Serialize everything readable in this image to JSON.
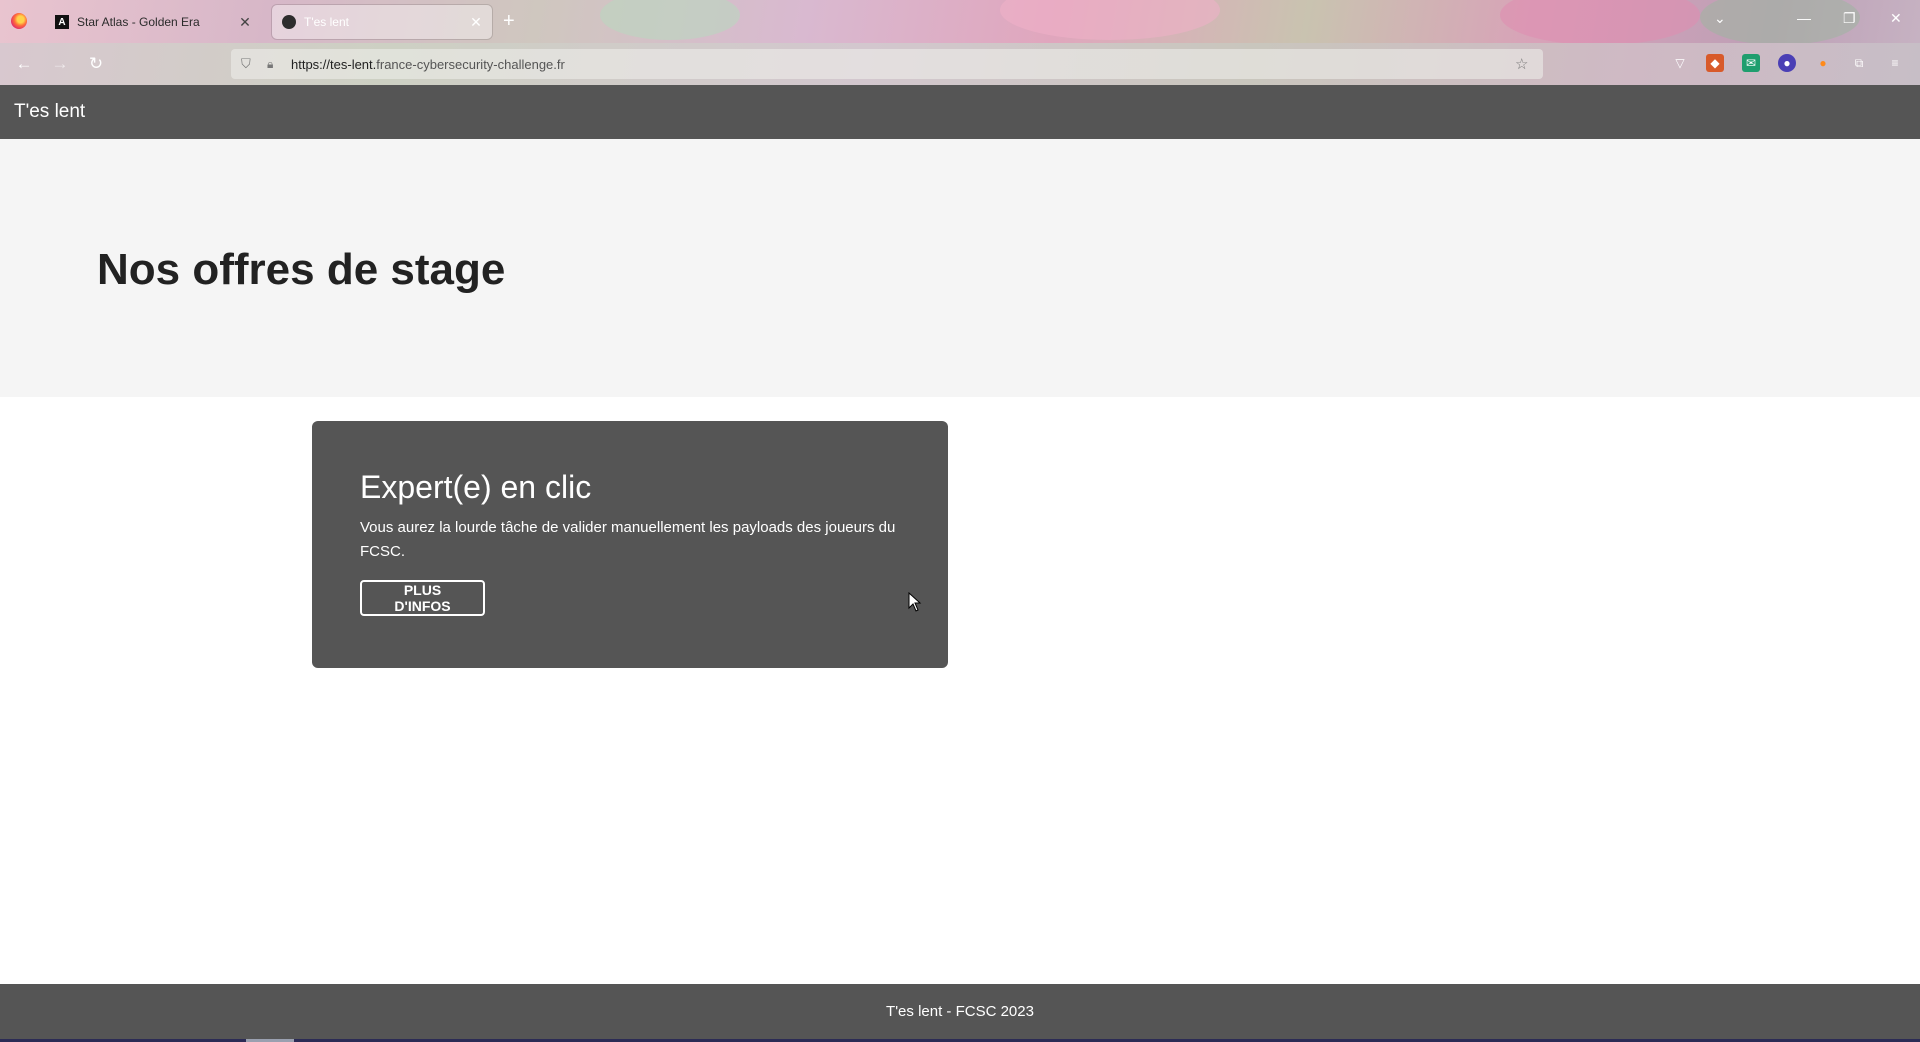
{
  "browser": {
    "tabs": [
      {
        "title": "Star Atlas - Golden Era",
        "favicon": "A",
        "active": false
      },
      {
        "title": "T'es lent",
        "favicon": "",
        "active": true
      }
    ],
    "url_prefix": "https://tes-lent.",
    "url_host": "france-cybersecurity-challenge.fr"
  },
  "header": {
    "site_title": "T'es lent"
  },
  "hero": {
    "heading": "Nos offres de stage"
  },
  "card": {
    "title": "Expert(e) en clic",
    "description": "Vous aurez la lourde tâche de valider manuellement les payloads des joueurs du FCSC.",
    "button_label": "PLUS D'INFOS"
  },
  "footer": {
    "text": "T'es lent - FCSC 2023"
  },
  "colors": {
    "header_bg": "#555555",
    "hero_bg": "#f5f5f5",
    "card_bg": "#555555"
  }
}
